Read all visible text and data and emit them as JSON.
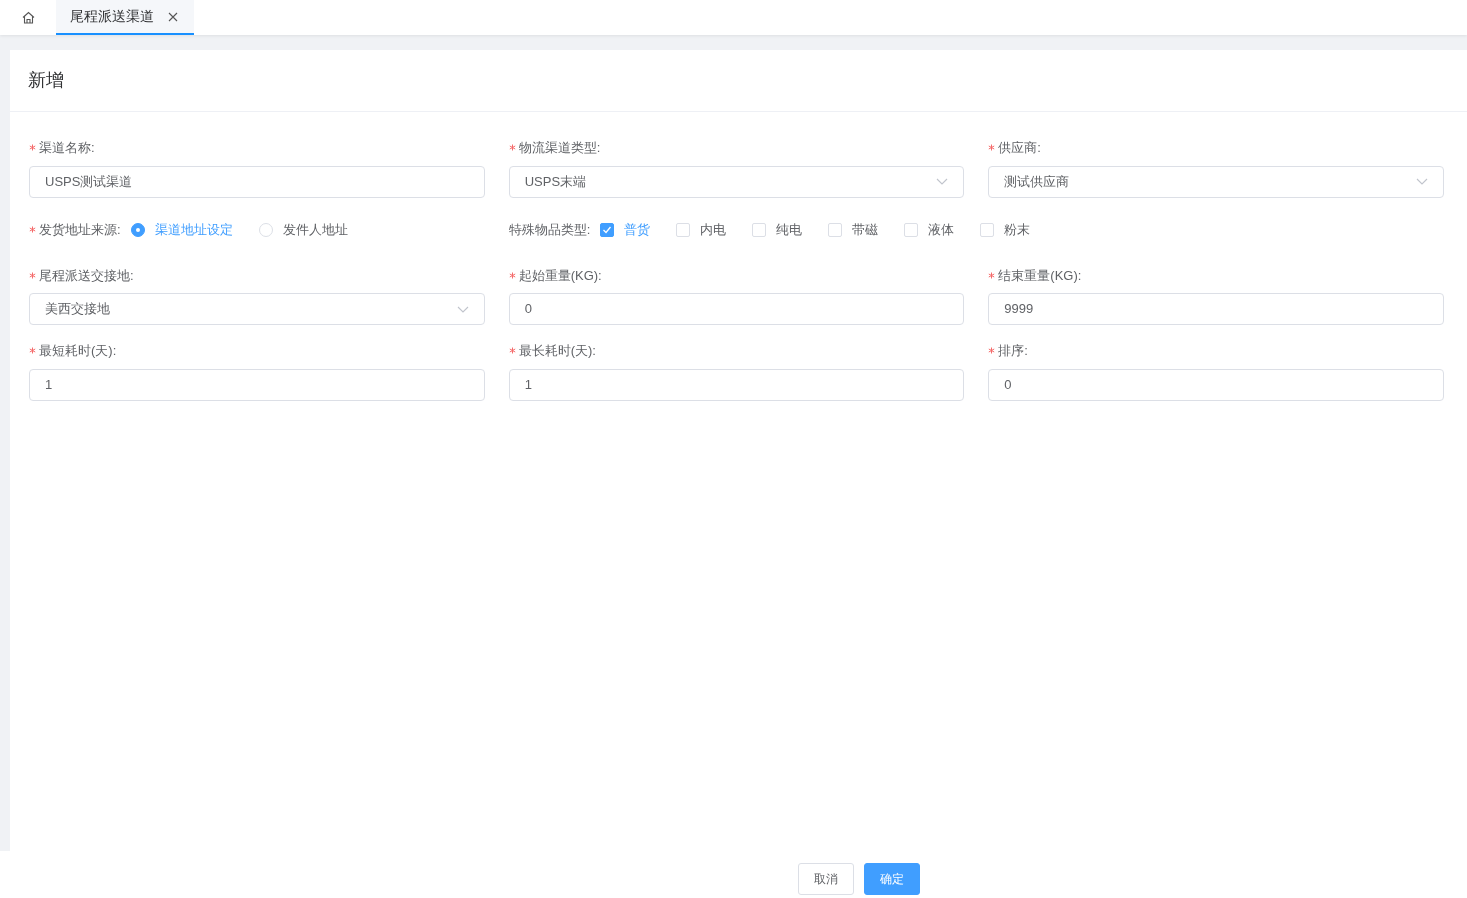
{
  "tabs": [
    {
      "kind": "home",
      "selected": false
    },
    {
      "kind": "page",
      "label": "尾程派送渠道",
      "closable": true,
      "selected": true
    }
  ],
  "panel": {
    "title": "新增"
  },
  "form_rows": [
    {
      "fields": [
        {
          "kind": "input",
          "label": "渠道名称:",
          "required": true,
          "value": "USPS测试渠道"
        },
        {
          "kind": "select",
          "label": "物流渠道类型:",
          "required": true,
          "value": "USPS末端"
        },
        {
          "kind": "select",
          "label": "供应商:",
          "required": true,
          "value": "测试供应商"
        }
      ]
    },
    {
      "fields": [
        {
          "kind": "radio",
          "label": "发货地址来源:",
          "required": true,
          "options": [
            {
              "label": "渠道地址设定",
              "selected": true
            },
            {
              "label": "发件人地址",
              "selected": false
            }
          ]
        },
        {
          "kind": "checkbox",
          "label": "特殊物品类型:",
          "required": false,
          "options": [
            {
              "label": "普货",
              "checked": true
            },
            {
              "label": "内电",
              "checked": false
            },
            {
              "label": "纯电",
              "checked": false
            },
            {
              "label": "带磁",
              "checked": false
            },
            {
              "label": "液体",
              "checked": false
            },
            {
              "label": "粉末",
              "checked": false
            }
          ]
        }
      ]
    },
    {
      "fields": [
        {
          "kind": "select",
          "label": "尾程派送交接地:",
          "required": true,
          "value": "美西交接地"
        },
        {
          "kind": "input",
          "label": "起始重量(KG):",
          "required": true,
          "value": "0"
        },
        {
          "kind": "input",
          "label": "结束重量(KG):",
          "required": true,
          "value": "9999"
        }
      ]
    },
    {
      "fields": [
        {
          "kind": "input",
          "label": "最短耗时(天):",
          "required": true,
          "value": "1"
        },
        {
          "kind": "input",
          "label": "最长耗时(天):",
          "required": true,
          "value": "1"
        },
        {
          "kind": "input",
          "label": "排序:",
          "required": true,
          "value": "0"
        }
      ]
    }
  ],
  "buttons": [
    {
      "kind": "default",
      "label": "取消"
    },
    {
      "kind": "primary",
      "label": "确定"
    }
  ]
}
